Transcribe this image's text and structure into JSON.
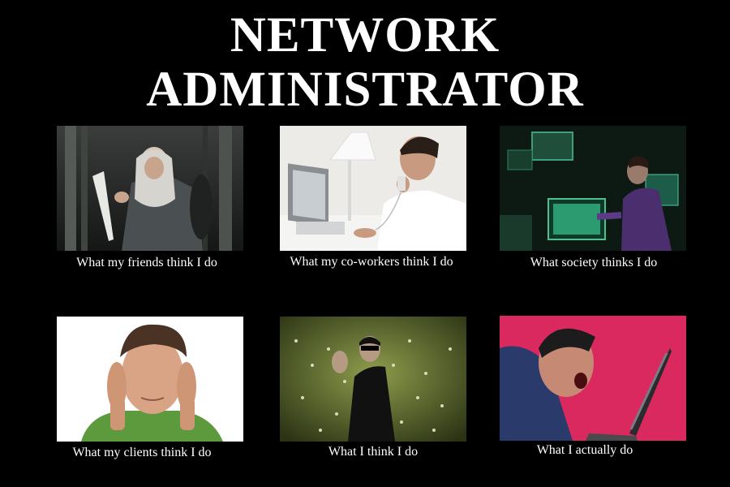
{
  "title": {
    "line1": "NETWORK",
    "line2": "ADMINISTRATOR"
  },
  "panels": [
    {
      "caption": "What my friends think I do"
    },
    {
      "caption": "What my co-workers think I do"
    },
    {
      "caption": "What society thinks I do"
    },
    {
      "caption": "What my clients think I do"
    },
    {
      "caption": "What I think I do"
    },
    {
      "caption": "What I actually do"
    }
  ]
}
